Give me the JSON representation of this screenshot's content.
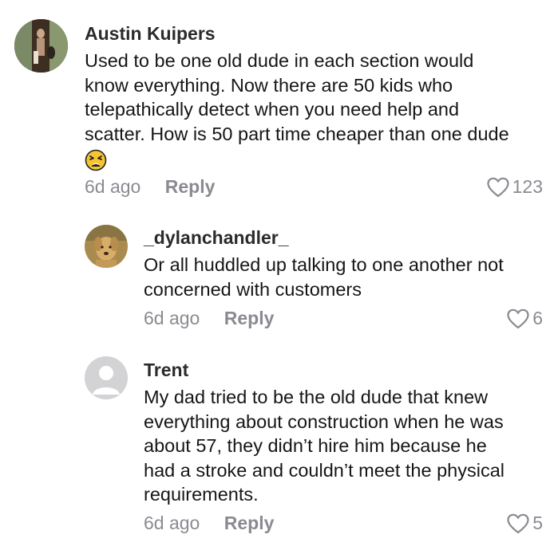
{
  "comments": [
    {
      "author": "Austin Kuipers",
      "lines": [
        "Used to be one old dude in each section would",
        "know everything. Now there are 50 kids who",
        "telepathically detect when you need help and",
        "scatter. How is 50 part time cheaper than one dude"
      ],
      "emoji": "tired-face-emoji",
      "time": "6d ago",
      "reply_label": "Reply",
      "likes": "123"
    },
    {
      "author": "_dylanchandler_",
      "lines": [
        "Or all huddled up talking to one another not",
        "concerned with customers"
      ],
      "time": "6d ago",
      "reply_label": "Reply",
      "likes": "6"
    },
    {
      "author": "Trent",
      "lines": [
        "My dad tried to be the old dude that knew",
        "everything about construction when he was",
        "about 57, they didn’t hire him because he",
        "had a stroke and couldn’t meet the physical",
        "requirements."
      ],
      "time": "6d ago",
      "reply_label": "Reply",
      "likes": "5"
    }
  ],
  "icons": {
    "like": "heart-outline-icon",
    "default_avatar": "default-avatar-icon"
  }
}
